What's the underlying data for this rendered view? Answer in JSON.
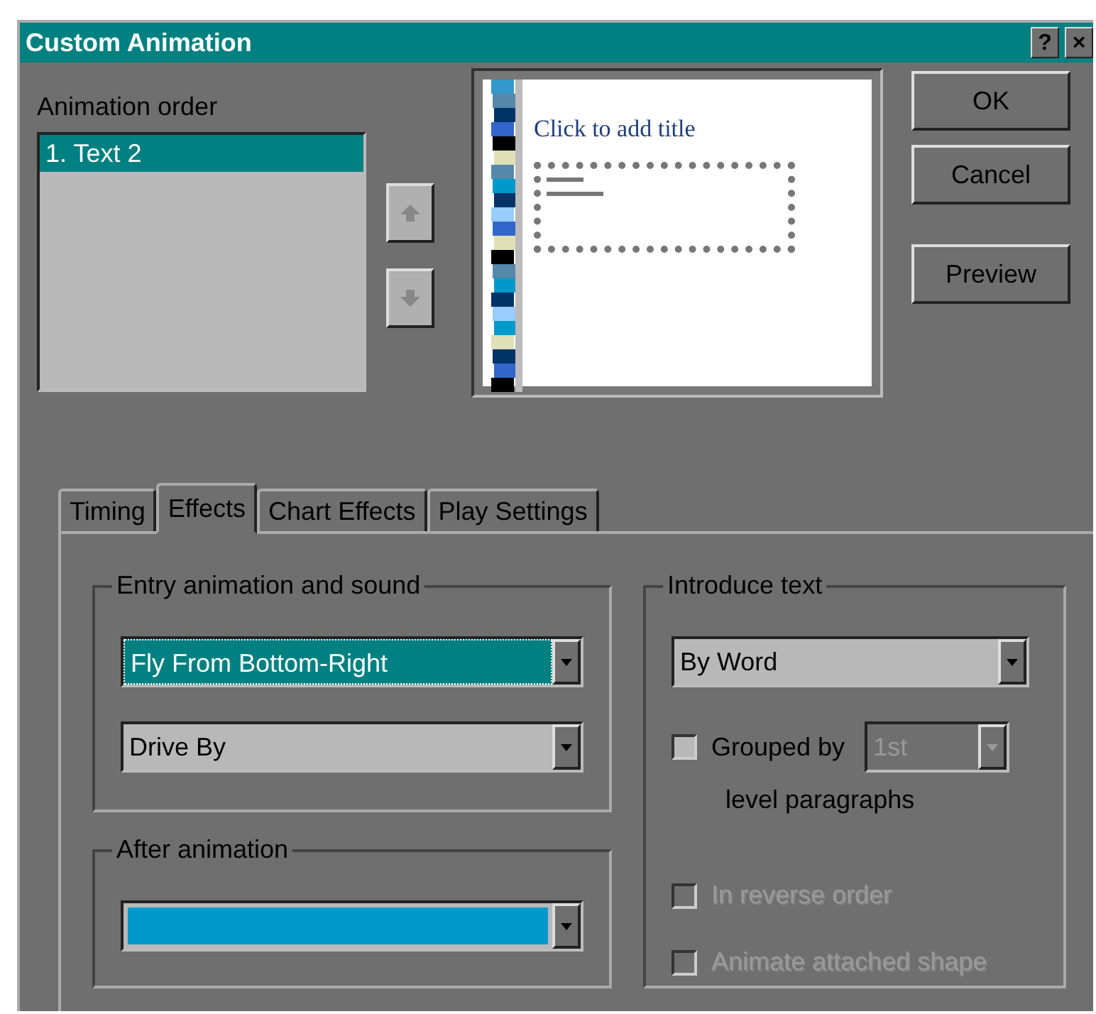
{
  "window": {
    "title": "Custom Animation",
    "help": "?",
    "close": "×"
  },
  "animation_order": {
    "label": "Animation order",
    "items": [
      {
        "label": "1. Text 2",
        "selected": true
      }
    ]
  },
  "preview_slide": {
    "title": "Click to add title"
  },
  "buttons": [
    {
      "label": "OK"
    },
    {
      "label": "Cancel"
    },
    {
      "label": "Preview"
    }
  ],
  "tabs": [
    {
      "label": "Timing",
      "selected": false
    },
    {
      "label": "Effects",
      "selected": true
    },
    {
      "label": "Chart Effects",
      "selected": false
    },
    {
      "label": "Play Settings",
      "selected": false
    }
  ],
  "entry_group": {
    "label": "Entry animation and sound",
    "effect": {
      "value": "Fly From Bottom-Right",
      "focused": true
    },
    "sound": {
      "value": "Drive By",
      "focused": false
    }
  },
  "after_group": {
    "label": "After animation",
    "color": "#0099cc"
  },
  "introduce_group": {
    "label": "Introduce text",
    "mode": {
      "value": "By Word"
    },
    "options": [
      {
        "kind": "grouped",
        "label": "Grouped by",
        "checked": false,
        "disabled": false,
        "level": {
          "value": "1st",
          "disabled": true
        },
        "note": "level paragraphs"
      },
      {
        "kind": "check",
        "label": "In reverse order",
        "checked": false,
        "disabled": true
      },
      {
        "kind": "check",
        "label": "Animate attached shape",
        "checked": false,
        "disabled": true
      }
    ]
  }
}
